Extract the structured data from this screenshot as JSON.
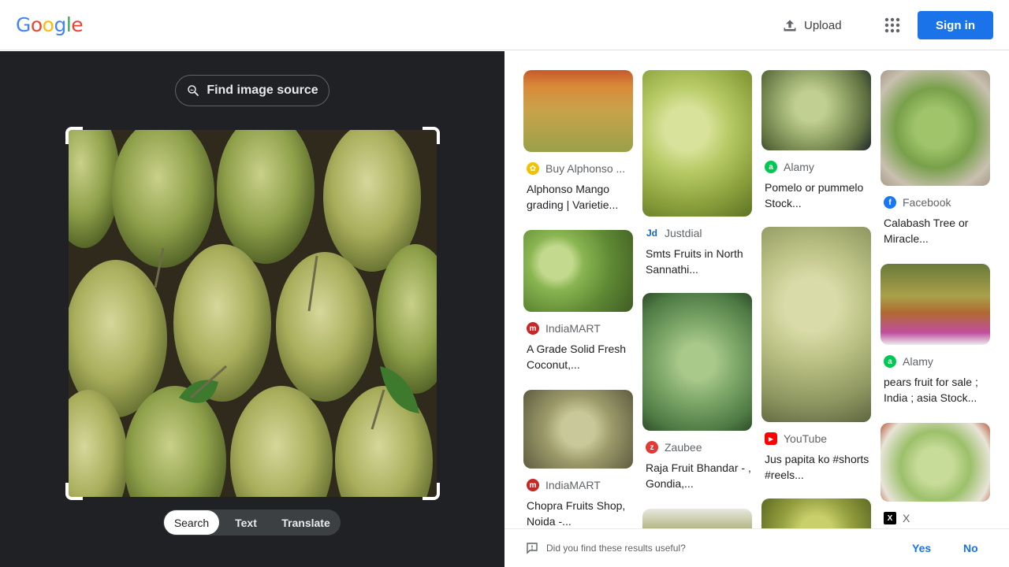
{
  "header": {
    "logo_letters": [
      {
        "ch": "G",
        "color": "#4285F4"
      },
      {
        "ch": "o",
        "color": "#EA4335"
      },
      {
        "ch": "o",
        "color": "#FBBC05"
      },
      {
        "ch": "g",
        "color": "#4285F4"
      },
      {
        "ch": "l",
        "color": "#34A853"
      },
      {
        "ch": "e",
        "color": "#EA4335"
      }
    ],
    "upload_label": "Upload",
    "apps_icon": "apps-grid-icon",
    "signin_label": "Sign in"
  },
  "left": {
    "find_source_label": "Find image source",
    "tabs": [
      {
        "label": "Search",
        "active": true
      },
      {
        "label": "Text",
        "active": false
      },
      {
        "label": "Translate",
        "active": false
      }
    ]
  },
  "results": {
    "columns": [
      [
        {
          "source": "Buy Alphonso ...",
          "icon": "alphonso-site-icon",
          "icon_color": "#f2c200",
          "title": "Alphonso Mango grading | Varietie..."
        },
        {
          "source": "IndiaMART",
          "icon": "indiamart-icon",
          "icon_color": "#c62828",
          "title": "A Grade Solid Fresh Coconut,..."
        },
        {
          "source": "IndiaMART",
          "icon": "indiamart-icon",
          "icon_color": "#c62828",
          "title": "Chopra Fruits Shop, Noida -..."
        }
      ],
      [
        {
          "source": "Justdial",
          "icon": "justdial-icon",
          "icon_color": "#1565c0",
          "title": "Smts Fruits in North Sannathi..."
        },
        {
          "source": "Zaubee",
          "icon": "zaubee-icon",
          "icon_color": "#e53935",
          "title": "Raja Fruit Bhandar - , Gondia,..."
        },
        {
          "source": "",
          "icon": "",
          "icon_color": "",
          "title": ""
        }
      ],
      [
        {
          "source": "Alamy",
          "icon": "alamy-icon",
          "icon_color": "#00c853",
          "title": "Pomelo or pummelo Stock..."
        },
        {
          "source": "YouTube",
          "icon": "youtube-icon",
          "icon_color": "#ff0000",
          "title": "Jus papita ko #shorts #reels..."
        },
        {
          "source": "",
          "icon": "",
          "icon_color": "",
          "title": ""
        }
      ],
      [
        {
          "source": "Facebook",
          "icon": "facebook-icon",
          "icon_color": "#1877f2",
          "title": "Calabash Tree or Miracle..."
        },
        {
          "source": "Alamy",
          "icon": "alamy-icon",
          "icon_color": "#00c853",
          "title": "pears fruit for sale ; India ; asia Stock..."
        },
        {
          "source": "X",
          "icon": "x-icon",
          "icon_color": "#000000",
          "title": ""
        }
      ]
    ]
  },
  "feedback": {
    "question": "Did you find these results useful?",
    "yes_label": "Yes",
    "no_label": "No"
  }
}
